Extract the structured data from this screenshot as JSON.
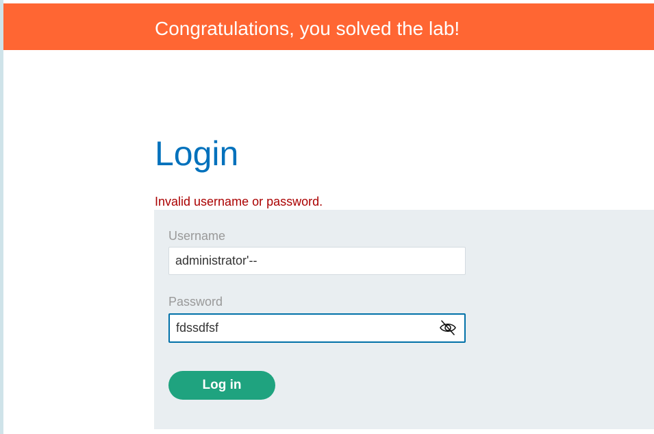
{
  "banner": {
    "message": "Congratulations, you solved the lab!",
    "color": "#ff6633"
  },
  "login": {
    "title": "Login",
    "error_message": "Invalid username or password.",
    "username_label": "Username",
    "username_value": "administrator'--",
    "password_label": "Password",
    "password_value": "fdssdfsf",
    "password_toggle_icon": "eye-slash-icon",
    "submit_label": "Log in",
    "accent_color": "#0071bc",
    "button_color": "#1fa37f",
    "error_color": "#aa0000"
  }
}
